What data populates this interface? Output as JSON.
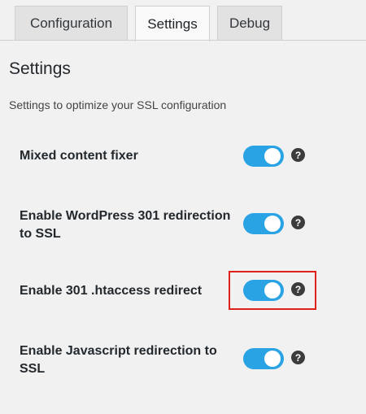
{
  "tabs": [
    {
      "label": "Configuration",
      "active": false
    },
    {
      "label": "Settings",
      "active": true
    },
    {
      "label": "Debug",
      "active": false
    }
  ],
  "section": {
    "title": "Settings",
    "description": "Settings to optimize your SSL configuration"
  },
  "settings": [
    {
      "label": "Mixed content fixer",
      "enabled": true,
      "help_glyph": "?"
    },
    {
      "label": "Enable WordPress 301 redirection to SSL",
      "enabled": true,
      "help_glyph": "?"
    },
    {
      "label": "Enable 301 .htaccess redirect",
      "enabled": true,
      "help_glyph": "?",
      "highlighted": true
    },
    {
      "label": "Enable Javascript redirection to SSL",
      "enabled": true,
      "help_glyph": "?"
    }
  ],
  "colors": {
    "toggle_on": "#29a3e4",
    "highlight": "#e0201a",
    "background": "#f1f1f1"
  }
}
